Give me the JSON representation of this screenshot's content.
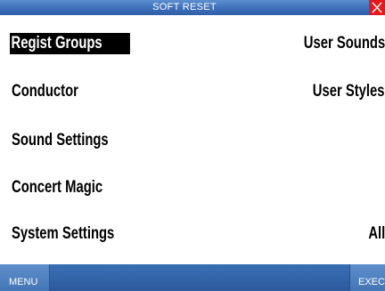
{
  "title_bar": {
    "title": "SOFT RESET"
  },
  "close_icon": "close-icon",
  "colors": {
    "accent": "#3e6fb8",
    "close": "#e81818",
    "selected_bg": "#000000"
  },
  "items_left": [
    {
      "label": "Regist Groups",
      "selected": true
    },
    {
      "label": "Conductor",
      "selected": false
    },
    {
      "label": "Sound Settings",
      "selected": false
    },
    {
      "label": "Concert Magic",
      "selected": false
    },
    {
      "label": "System Settings",
      "selected": false
    }
  ],
  "items_right": [
    {
      "label": "User Sounds"
    },
    {
      "label": "User Styles"
    },
    {
      "label": "All"
    }
  ],
  "soft_keys": {
    "menu": "MENU",
    "exec": "EXEC"
  }
}
